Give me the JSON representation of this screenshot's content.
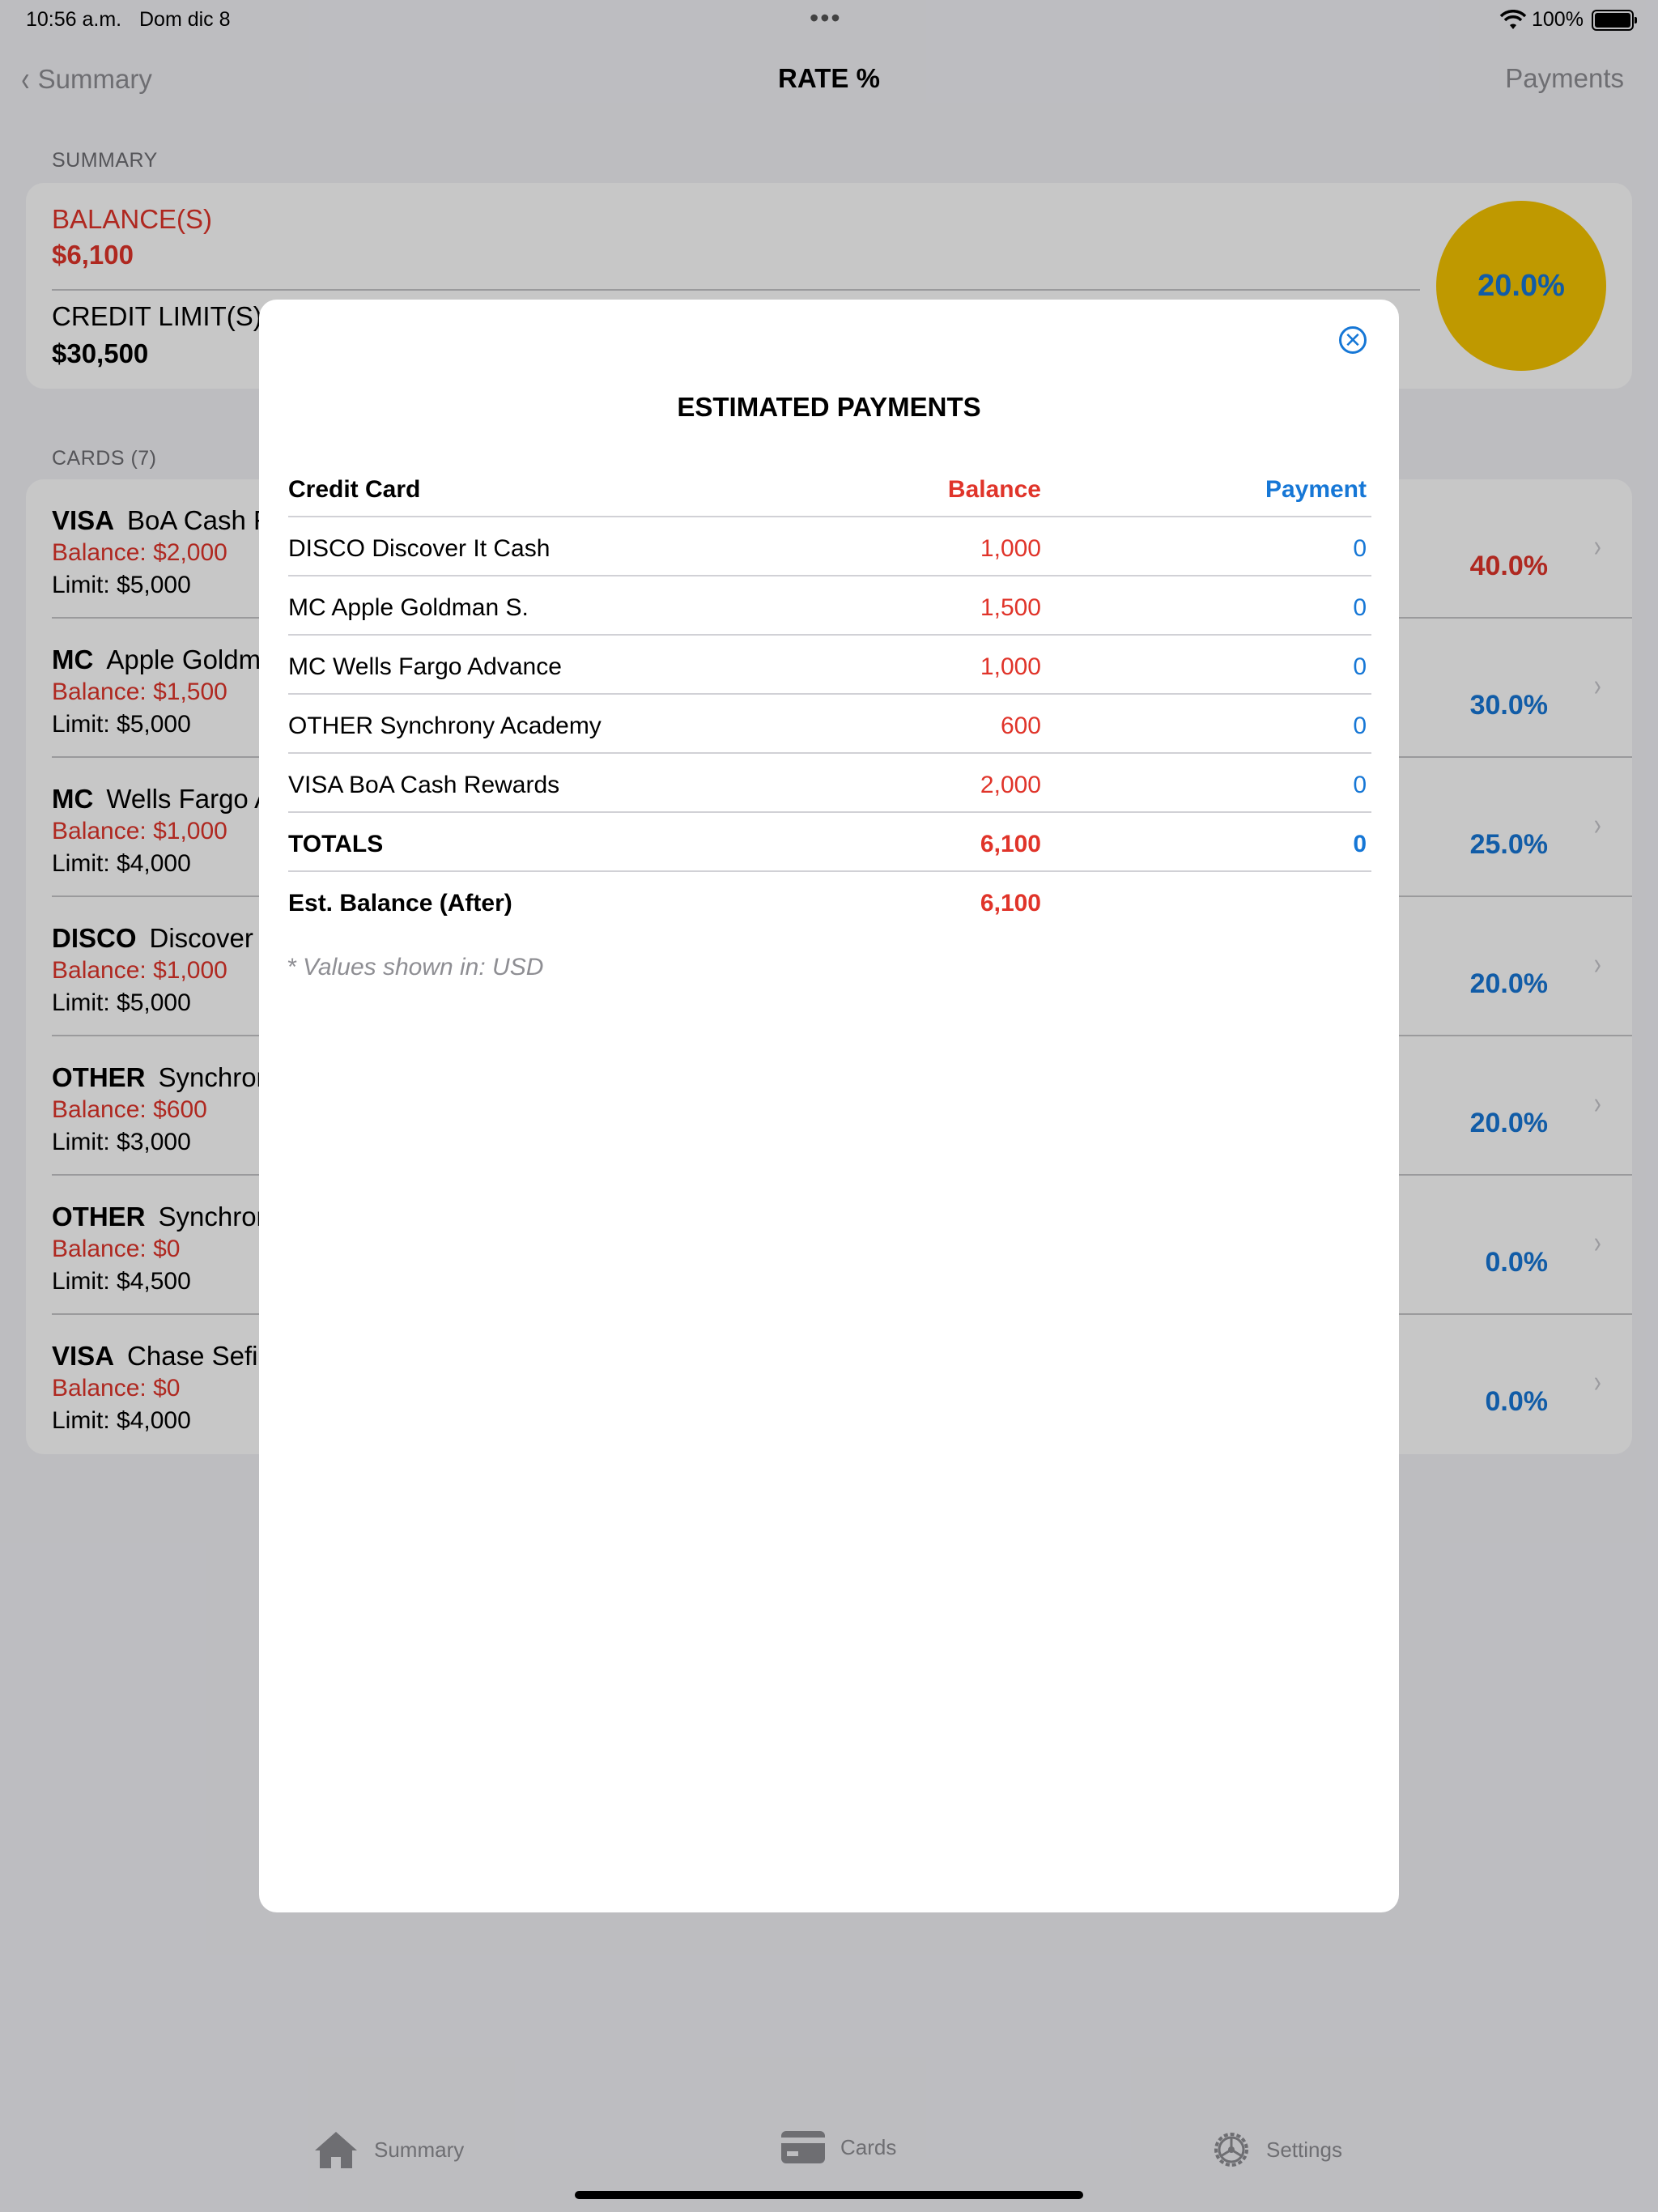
{
  "status_bar": {
    "time": "10:56 a.m.",
    "date": "Dom dic 8",
    "battery": "100%"
  },
  "nav": {
    "back_label": "Summary",
    "title": "RATE %",
    "right_label": "Payments"
  },
  "summary": {
    "section_header": "SUMMARY",
    "balance_label": "BALANCE(S)",
    "balance_value": "$6,100",
    "credit_label": "CREDIT LIMIT(S)",
    "credit_value": "$30,500",
    "rate": "20.0%",
    "gauge_color": "#f5c400"
  },
  "cards": {
    "section_header": "CARDS (7)",
    "items": [
      {
        "network": "VISA",
        "name": "BoA Cash Rewards",
        "balance": "Balance: $2,000",
        "limit": "Limit: $5,000",
        "rate": "40.0%",
        "rate_color": "#e0342a"
      },
      {
        "network": "MC",
        "name": "Apple Goldman S.",
        "balance": "Balance: $1,500",
        "limit": "Limit: $5,000",
        "rate": "30.0%",
        "rate_color": "#1677d6"
      },
      {
        "network": "MC",
        "name": "Wells Fargo Advance",
        "balance": "Balance: $1,000",
        "limit": "Limit: $4,000",
        "rate": "25.0%",
        "rate_color": "#1677d6"
      },
      {
        "network": "DISCO",
        "name": "Discover It Cash",
        "balance": "Balance: $1,000",
        "limit": "Limit: $5,000",
        "rate": "20.0%",
        "rate_color": "#1677d6"
      },
      {
        "network": "OTHER",
        "name": "Synchrony Academy",
        "balance": "Balance: $600",
        "limit": "Limit: $3,000",
        "rate": "20.0%",
        "rate_color": "#1677d6"
      },
      {
        "network": "OTHER",
        "name": "Synchrony",
        "balance": "Balance: $0",
        "limit": "Limit: $4,500",
        "rate": "0.0%",
        "rate_color": "#1677d6"
      },
      {
        "network": "VISA",
        "name": "Chase Sefi",
        "balance": "Balance: $0",
        "limit": "Limit: $4,000",
        "rate": "0.0%",
        "rate_color": "#1677d6"
      }
    ]
  },
  "modal": {
    "title": "ESTIMATED PAYMENTS",
    "close_icon": "close-circle-icon",
    "headers": {
      "card": "Credit Card",
      "balance": "Balance",
      "payment": "Payment"
    },
    "rows": [
      {
        "card": "DISCO Discover It Cash",
        "balance": "1,000",
        "payment": "0"
      },
      {
        "card": "MC Apple Goldman S.",
        "balance": "1,500",
        "payment": "0"
      },
      {
        "card": "MC Wells Fargo Advance",
        "balance": "1,000",
        "payment": "0"
      },
      {
        "card": "OTHER Synchrony Academy",
        "balance": "600",
        "payment": "0"
      },
      {
        "card": "VISA BoA Cash Rewards",
        "balance": "2,000",
        "payment": "0"
      }
    ],
    "totals": {
      "card": "TOTALS",
      "balance": "6,100",
      "payment": "0"
    },
    "after": {
      "card": "Est. Balance (After)",
      "balance": "6,100"
    },
    "note": "* Values shown in: USD"
  },
  "tabs": [
    {
      "label": "Summary",
      "icon": "house-icon"
    },
    {
      "label": "Cards",
      "icon": "credit-card-icon"
    },
    {
      "label": "Settings",
      "icon": "gear-icon"
    }
  ],
  "colors": {
    "accent_blue": "#1677d6",
    "balance_red": "#e0342a"
  }
}
